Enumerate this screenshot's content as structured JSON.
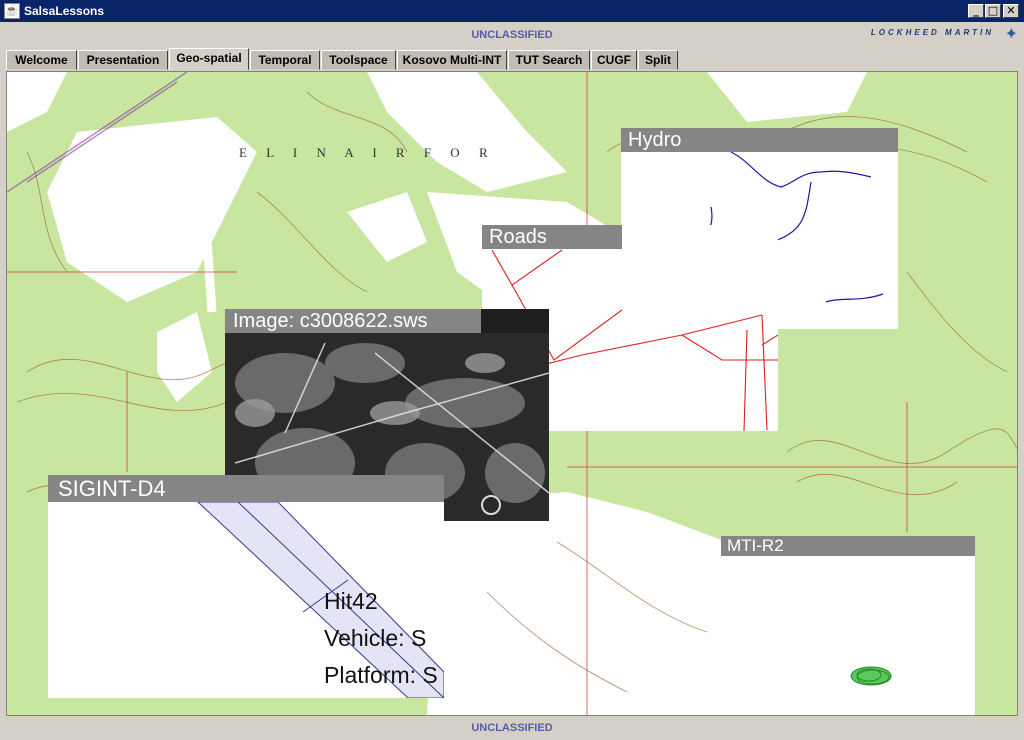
{
  "window": {
    "title": "SalsaLessons"
  },
  "banner": {
    "top": "UNCLASSIFIED",
    "bottom": "UNCLASSIFIED"
  },
  "logo": {
    "text": "LOCKHEED MARTIN"
  },
  "tabs": [
    {
      "label": "Welcome",
      "active": false
    },
    {
      "label": "Presentation",
      "active": false
    },
    {
      "label": "Geo-spatial",
      "active": true
    },
    {
      "label": "Temporal",
      "active": false
    },
    {
      "label": "Toolspace",
      "active": false
    },
    {
      "label": "Kosovo Multi-INT",
      "active": false
    },
    {
      "label": "TUT Search",
      "active": false
    },
    {
      "label": "CUGF",
      "active": false
    },
    {
      "label": "Split",
      "active": false
    }
  ],
  "map": {
    "base_label": "E L I N   A I R   F O R",
    "colors": {
      "vegetation": "#c8e6a0",
      "contour": "#a05a28",
      "roads": "#e02020",
      "hydro": "#1a1aa8",
      "header": "#858585",
      "mti_track": "#2aa82a"
    }
  },
  "panels": {
    "hydro": {
      "title": "Hydro"
    },
    "roads": {
      "title": "Roads"
    },
    "image": {
      "title": "Image: c3008622.sws"
    },
    "sigint": {
      "title": "SIGINT-D4",
      "hit": "Hit42",
      "vehicle": "Vehicle: S",
      "platform": "Platform: S"
    },
    "mti": {
      "title": "MTI-R2"
    }
  }
}
